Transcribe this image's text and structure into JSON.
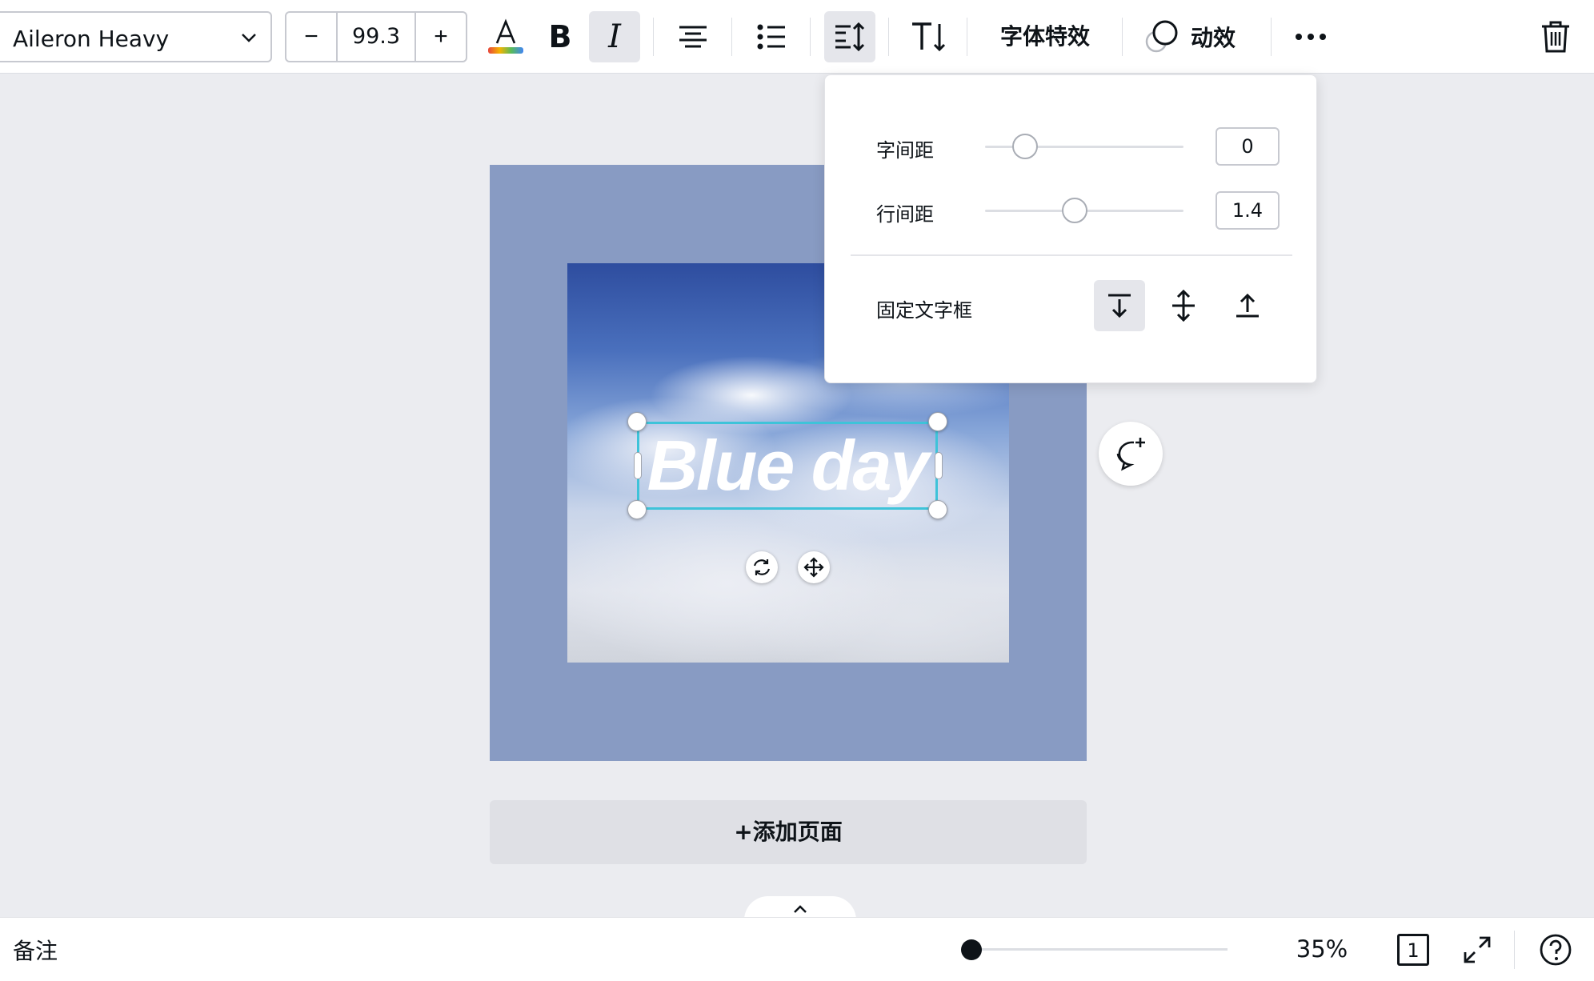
{
  "toolbar": {
    "font_name": "Aileron Heavy",
    "font_size": "99.3",
    "minus_label": "−",
    "plus_label": "+",
    "effects_label": "字体特效",
    "animate_label": "动效",
    "text_color_gradient": [
      "#e8453c",
      "#f4b400",
      "#57bb5b",
      "#4285f4"
    ],
    "icons": [
      "text-color-icon",
      "bold-icon",
      "italic-icon",
      "align-center-icon",
      "list-icon",
      "spacing-icon",
      "text-direction-icon",
      "animate-icon",
      "more-icon",
      "trash-icon"
    ]
  },
  "spacing_popover": {
    "letter_spacing_label": "字间距",
    "letter_spacing_value": "0",
    "line_spacing_label": "行间距",
    "line_spacing_value": "1.4",
    "fixed_textbox_label": "固定文字框",
    "anchor_options": [
      "anchor-top-icon",
      "anchor-middle-icon",
      "anchor-bottom-icon"
    ]
  },
  "canvas": {
    "text": "Blue day",
    "artboard_color": "#889bc3",
    "selection_color": "#3ec3d9",
    "add_page_label": "+添加页面"
  },
  "bottom_bar": {
    "notes_label": "备注",
    "zoom_value": "35%",
    "page_count": "1"
  }
}
